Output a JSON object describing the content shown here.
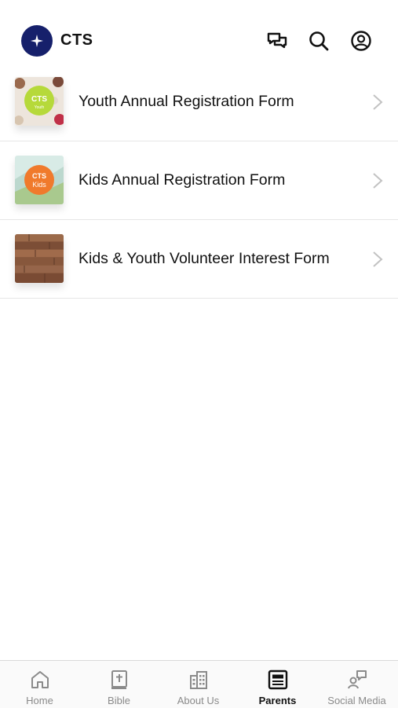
{
  "header": {
    "brand": "CTS",
    "icons": [
      "chat-icon",
      "search-icon",
      "profile-icon"
    ],
    "logo_color": "#16206b"
  },
  "list": {
    "items": [
      {
        "label": "Youth Annual Registration Form",
        "thumb_text_line1": "CTS",
        "thumb_text_line2": "Youth",
        "thumb_badge_color": "#b6d93a"
      },
      {
        "label": "Kids Annual Registration Form",
        "thumb_text_line1": "CTS",
        "thumb_text_line2": "Kids",
        "thumb_badge_color": "#f07a2c"
      },
      {
        "label": "Kids & Youth Volunteer Interest Form",
        "thumb_badge_color": "#8a5a3e"
      }
    ]
  },
  "tabbar": {
    "tabs": [
      {
        "label": "Home",
        "icon": "home-icon"
      },
      {
        "label": "Bible",
        "icon": "bible-icon"
      },
      {
        "label": "About Us",
        "icon": "building-icon"
      },
      {
        "label": "Parents",
        "icon": "form-icon",
        "active": true
      },
      {
        "label": "Social Media",
        "icon": "social-icon"
      }
    ],
    "active_color": "#111111",
    "inactive_color": "#8a8a8a"
  }
}
